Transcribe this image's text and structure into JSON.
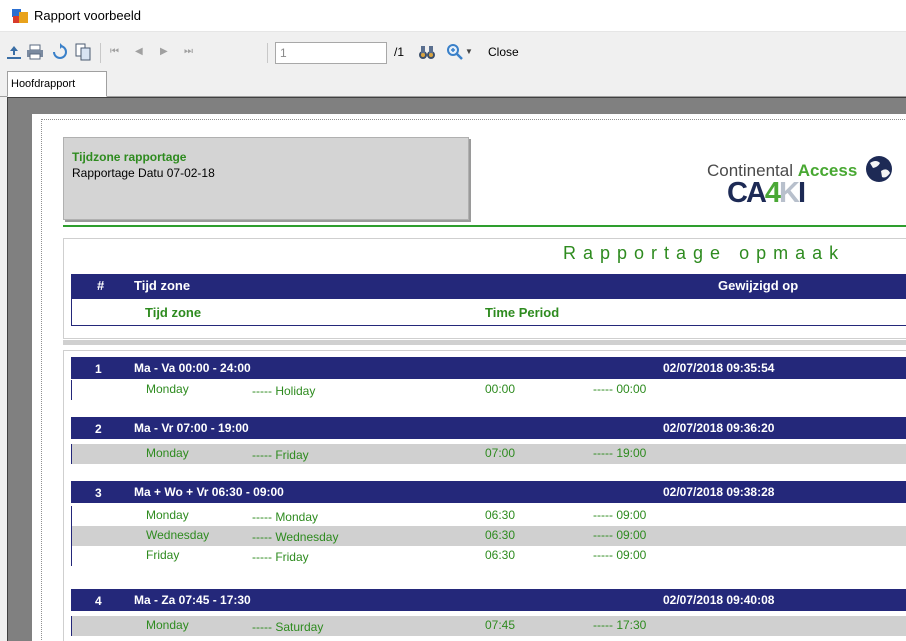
{
  "window": {
    "title": "Rapport voorbeeld"
  },
  "toolbar": {
    "page_value": "1",
    "page_total": "/1",
    "close_label": "Close",
    "nav_first": "⏮",
    "nav_prev": "◀",
    "nav_next": "▶",
    "nav_last": "⏭"
  },
  "tabs": {
    "main": "Hoofdrapport"
  },
  "report": {
    "info": {
      "title": "Tijdzone rapportage",
      "date": "Rapportage Datu 07-02-18"
    },
    "logo": {
      "text_main": "Continental ",
      "text_accent": "Access",
      "mark_a": "CA",
      "mark_4": "4",
      "mark_k": "K",
      "mark_i": "I"
    },
    "heading": "Rapportage opmaak",
    "columns": {
      "num": "#",
      "zone": "Tijd zone",
      "modified": "Gewijzigd op"
    },
    "subcolumns": {
      "zone": "Tijd zone",
      "period": "Time Period"
    },
    "groups": [
      {
        "num": "1",
        "name": "Ma - Va 00:00 - 24:00",
        "date": "02/07/2018 09:35:54",
        "rows": [
          {
            "from": "Monday",
            "to": "----- Holiday",
            "start": "00:00",
            "end": "----- 00:00"
          }
        ]
      },
      {
        "num": "2",
        "name": "Ma - Vr 07:00 - 19:00",
        "date": "02/07/2018 09:36:20",
        "rows": [
          {
            "from": "Monday",
            "to": "----- Friday",
            "start": "07:00",
            "end": "----- 19:00"
          }
        ]
      },
      {
        "num": "3",
        "name": "Ma + Wo + Vr 06:30 - 09:00",
        "date": "02/07/2018 09:38:28",
        "rows": [
          {
            "from": "Monday",
            "to": "----- Monday",
            "start": "06:30",
            "end": "----- 09:00"
          },
          {
            "from": "Wednesday",
            "to": "----- Wednesday",
            "start": "06:30",
            "end": "----- 09:00"
          },
          {
            "from": "Friday",
            "to": "----- Friday",
            "start": "06:30",
            "end": "----- 09:00"
          }
        ]
      },
      {
        "num": "4",
        "name": "Ma - Za 07:45 - 17:30",
        "date": "02/07/2018 09:40:08",
        "rows": [
          {
            "from": "Monday",
            "to": "----- Saturday",
            "start": "07:45",
            "end": "----- 17:30"
          }
        ]
      }
    ]
  },
  "colors": {
    "header_blue": "#24287a",
    "text_green": "#2e8b1f",
    "rule_green": "#2e9e2e"
  }
}
